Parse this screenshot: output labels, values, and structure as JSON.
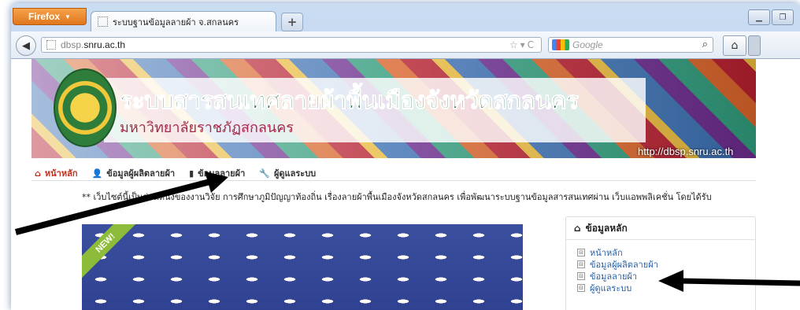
{
  "browser": {
    "menu_button": "Firefox",
    "tab_title": "ระบบฐานข้อมูลลายผ้า จ.สกลนคร",
    "new_tab": "+",
    "url_prefix": "dbsp.",
    "url_domain": "snru.ac.th",
    "search_placeholder": "Google"
  },
  "banner": {
    "title": "ระบบสารสนเทศลายผ้าพื้นเมืองจังหวัดสกลนคร",
    "subtitle": "มหาวิทยาลัยราชภัฏสกลนคร",
    "url": "http://dbsp.snru.ac.th"
  },
  "menu": [
    {
      "label": "หน้าหลัก",
      "icon": "home-icon"
    },
    {
      "label": "ข้อมูลผู้ผลิตลายผ้า",
      "icon": "user-icon"
    },
    {
      "label": "ข้อมูลลายผ้า",
      "icon": "book-icon"
    },
    {
      "label": "ผู้ดูแลระบบ",
      "icon": "wrench-icon"
    }
  ],
  "marquee": "** เว็บไซต์นี้เป็นส่วนหนึ่งของงานวิจัย การศึกษาภูมิปัญญาท้องถิ่น เรื่องลายผ้าพื้นเมืองจังหวัดสกลนคร เพื่อพัฒนาระบบฐานข้อมูลสารสนเทศผ่าน เว็บแอพพลิเคชั่น โดยได้รับ",
  "photo": {
    "ribbon": "NEW!"
  },
  "sidebar": {
    "title": "ข้อมูลหลัก",
    "items": [
      "หน้าหลัก",
      "ข้อมูลผู้ผลิตลายผ้า",
      "ข้อมูลลายผ้า",
      "ผู้ดูแลระบบ"
    ]
  },
  "colors": {
    "accent": "#c1301f",
    "link": "#2a5fa4",
    "annotation_arrow": "#000000"
  }
}
